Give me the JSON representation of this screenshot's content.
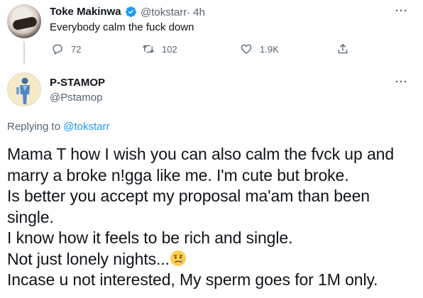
{
  "original_tweet": {
    "author_name": "Toke Makinwa",
    "author_handle": "@tokstarr",
    "time": "· 4h",
    "text": "Everybody calm the fuck down",
    "reply_count": "72",
    "retweet_count": "102",
    "like_count": "1.9K",
    "more_label": "···"
  },
  "reply_tweet": {
    "author_name": "P-STAMOP",
    "author_handle": "@Pstamop",
    "more_label": "···",
    "replying_to_prefix": "Replying to",
    "replying_to_handle": "@tokstarr",
    "lines": [
      "Mama T how I wish you can also calm the fvck up and",
      "marry a broke n!gga like me. I'm cute but broke.",
      "Is better you accept my proposal ma'am than been",
      "single.",
      "I know how it feels to be rich and single.",
      "Not just lonely nights...",
      "Incase u not interested, My sperm goes for 1M only."
    ]
  },
  "colors": {
    "text": "#0f1419",
    "secondary": "#536471",
    "accent": "#1d9bf0"
  },
  "icons": [
    "verified-badge-icon",
    "reply-icon",
    "retweet-icon",
    "like-icon",
    "share-icon",
    "crying-face-emoji"
  ]
}
